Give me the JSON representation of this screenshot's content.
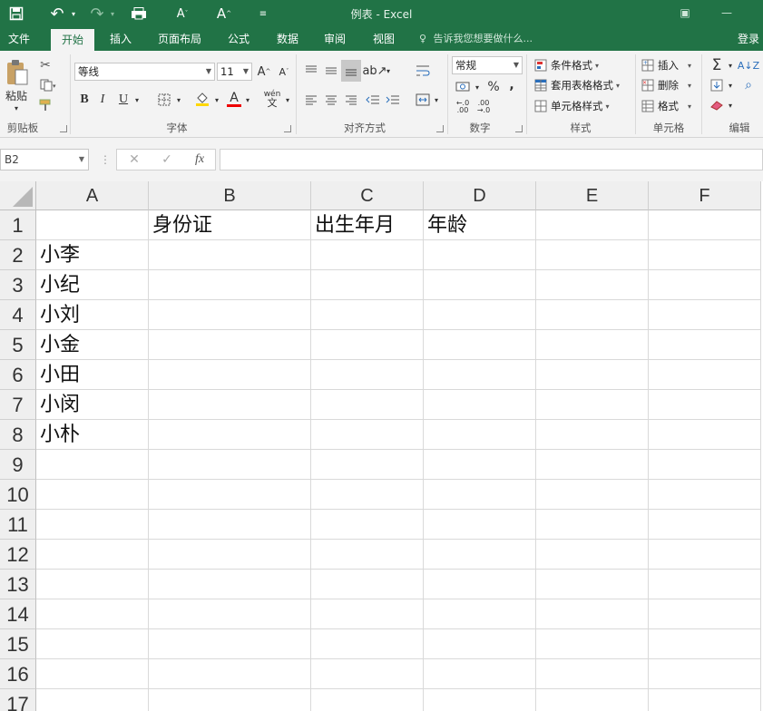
{
  "titlebar": {
    "title": "例表 - Excel",
    "save_icon": "save-icon",
    "undo_glyph": "↶",
    "redo_glyph": "↷",
    "grow_font_glyph": "A",
    "shrink_font_glyph": "A",
    "customize_glyph": "⌄",
    "restore_glyph": "▣",
    "minimize_glyph": "—"
  },
  "tabs": [
    {
      "label": "文件"
    },
    {
      "label": "开始"
    },
    {
      "label": "插入"
    },
    {
      "label": "页面布局"
    },
    {
      "label": "公式"
    },
    {
      "label": "数据"
    },
    {
      "label": "审阅"
    },
    {
      "label": "视图"
    }
  ],
  "tell_me": "告诉我您想要做什么...",
  "login": "登录",
  "ribbon": {
    "clipboard": {
      "paste_label": "粘贴",
      "group_label": "剪贴板"
    },
    "font": {
      "font_name": "等线",
      "font_size": "11",
      "bold": "B",
      "italic": "I",
      "underline": "U",
      "font_color_glyph": "A",
      "phonetic_glyph": "wén",
      "group_label": "字体"
    },
    "alignment": {
      "group_label": "对齐方式"
    },
    "number": {
      "format": "常规",
      "percent": "%",
      "comma": ",",
      "group_label": "数字"
    },
    "styles": {
      "conditional": "条件格式",
      "table": "套用表格格式",
      "cell_styles": "单元格样式",
      "group_label": "样式"
    },
    "cells": {
      "insert": "插入",
      "delete": "删除",
      "format": "格式",
      "group_label": "单元格"
    },
    "editing": {
      "sum_glyph": "Σ",
      "group_label": "编辑"
    }
  },
  "formula_bar": {
    "name_box": "B2",
    "dots": "⋮",
    "cancel_glyph": "✕",
    "enter_glyph": "✓",
    "fx_glyph": "fx",
    "value": ""
  },
  "sheet": {
    "columns": [
      "A",
      "B",
      "C",
      "D",
      "E",
      "F"
    ],
    "rows": [
      "1",
      "2",
      "3",
      "4",
      "5",
      "6",
      "7",
      "8",
      "9",
      "10",
      "11",
      "12",
      "13",
      "14",
      "15",
      "16",
      "17"
    ],
    "cells": {
      "B1": "身份证",
      "C1": "出生年月",
      "D1": "年龄",
      "A2": "小李",
      "A3": "小纪",
      "A4": "小刘",
      "A5": "小金",
      "A6": "小田",
      "A7": "小闵",
      "A8": "小朴"
    }
  },
  "colors": {
    "accent": "#217346",
    "ribbon_bg": "#f3f3f3",
    "grid_line": "#d9d9d9"
  }
}
